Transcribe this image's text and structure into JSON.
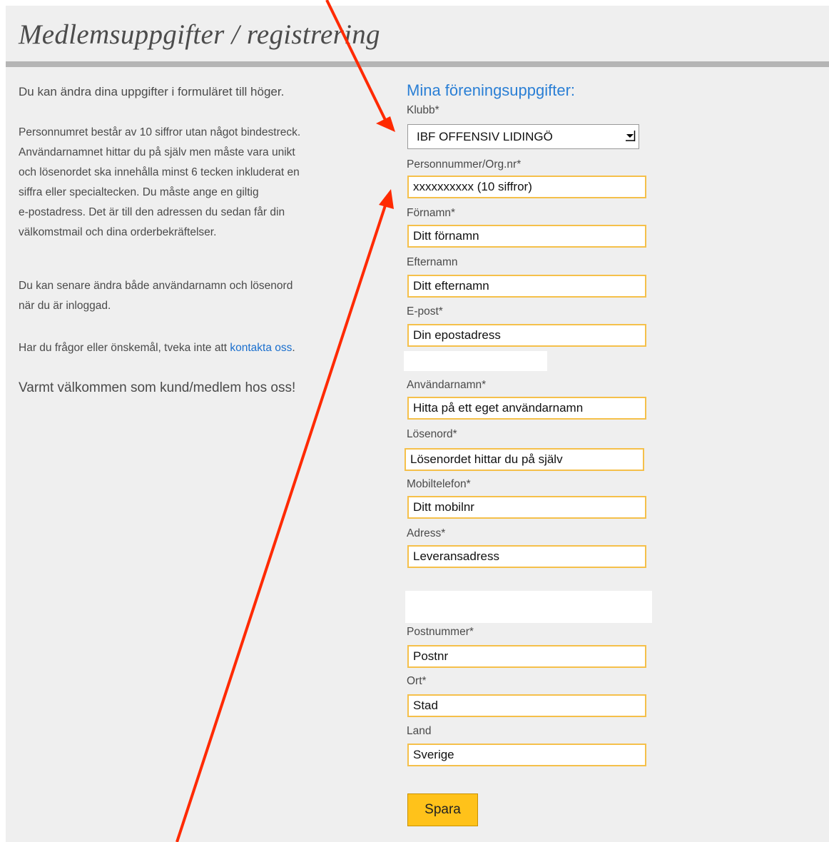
{
  "title": "Medlemsuppgifter / registrering",
  "left": {
    "intro": "Du kan ändra dina uppgifter i formuläret till höger.",
    "para1_lines": [
      "Personnumret består av 10 siffror utan något bindestreck.",
      "Användarnamnet hittar du på själv men måste vara unikt",
      "och lösenordet ska innehålla minst 6 tecken inkluderat en",
      "siffra eller specialtecken. Du måste ange en giltig",
      "e-postadress. Det är till den adressen du sedan får din",
      "välkomstmail och dina orderbekräftelser."
    ],
    "para2_lines": [
      "Du kan senare ändra både användarnamn och lösenord",
      "när du är inloggad."
    ],
    "para3_text": "Har du frågor eller önskemål, tveka inte att ",
    "para3_link": "kontakta oss",
    "para3_end": ".",
    "welcome": "Varmt välkommen som kund/medlem hos oss!"
  },
  "form": {
    "heading": "Mina föreningsuppgifter:",
    "club": {
      "label": "Klubb*",
      "value": "IBF OFFENSIV LIDINGÖ"
    },
    "personnummer": {
      "label": "Personnummer/Org.nr*",
      "value": "xxxxxxxxxx (10 siffror)"
    },
    "fornamn": {
      "label": "Förnamn*",
      "value": "Ditt förnamn"
    },
    "efternamn": {
      "label": "Efternamn",
      "value": "Ditt efternamn"
    },
    "epost": {
      "label": "E-post*",
      "value": "Din epostadress"
    },
    "anvandarnamn": {
      "label": "Användarnamn*",
      "value": "Hitta på ett eget användarnamn"
    },
    "losenord": {
      "label": "Lösenord*",
      "value": "Lösenordet hittar du på själv"
    },
    "mobil": {
      "label": "Mobiltelefon*",
      "value": "Ditt mobilnr"
    },
    "adress": {
      "label": "Adress*",
      "value": "Leveransadress"
    },
    "postnummer": {
      "label": "Postnummer*",
      "value": "Postnr"
    },
    "ort": {
      "label": "Ort*",
      "value": "Stad"
    },
    "land": {
      "label": "Land",
      "value": "Sverige"
    },
    "save_label": "Spara"
  },
  "colors": {
    "annotation_arrow": "#ff2a00",
    "field_border": "#f5c04a",
    "button": "#ffc21a",
    "heading_blue": "#2a7fd5",
    "link_blue": "#1a6fce"
  }
}
